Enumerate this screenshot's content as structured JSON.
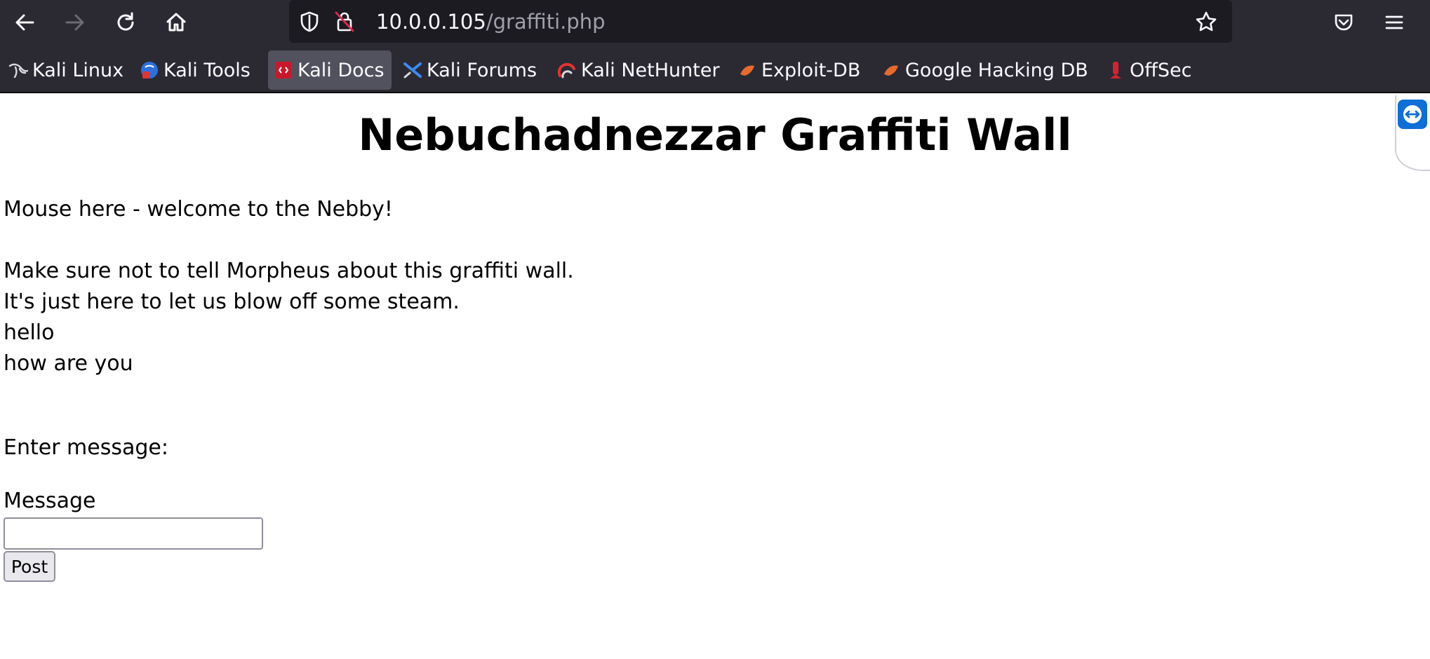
{
  "browser": {
    "url_host": "10.0.0.105",
    "url_path": "/graffiti.php",
    "bookmarks": [
      {
        "label": "Kali Linux",
        "icon": "kali-dragon-icon"
      },
      {
        "label": "Kali Tools",
        "icon": "kali-tools-icon"
      },
      {
        "label": "Kali Docs",
        "icon": "kali-docs-icon",
        "active": true
      },
      {
        "label": "Kali Forums",
        "icon": "kali-forums-icon"
      },
      {
        "label": "Kali NetHunter",
        "icon": "kali-nethunter-icon"
      },
      {
        "label": "Exploit-DB",
        "icon": "exploit-db-icon"
      },
      {
        "label": "Google Hacking DB",
        "icon": "ghdb-icon"
      },
      {
        "label": "OffSec",
        "icon": "offsec-icon"
      }
    ],
    "colors": {
      "chrome_bg": "#2b2a33",
      "urlbar_bg": "#1c1b22"
    }
  },
  "page": {
    "title": "Nebuchadnezzar Graffiti Wall",
    "lines": [
      "Mouse here - welcome to the Nebby!",
      "Make sure not to tell Morpheus about this graffiti wall.",
      "It's just here to let us blow off some steam.",
      "hello",
      "how are you"
    ],
    "form": {
      "prompt": "Enter message:",
      "field_label": "Message",
      "field_value": "",
      "submit_label": "Post"
    }
  }
}
